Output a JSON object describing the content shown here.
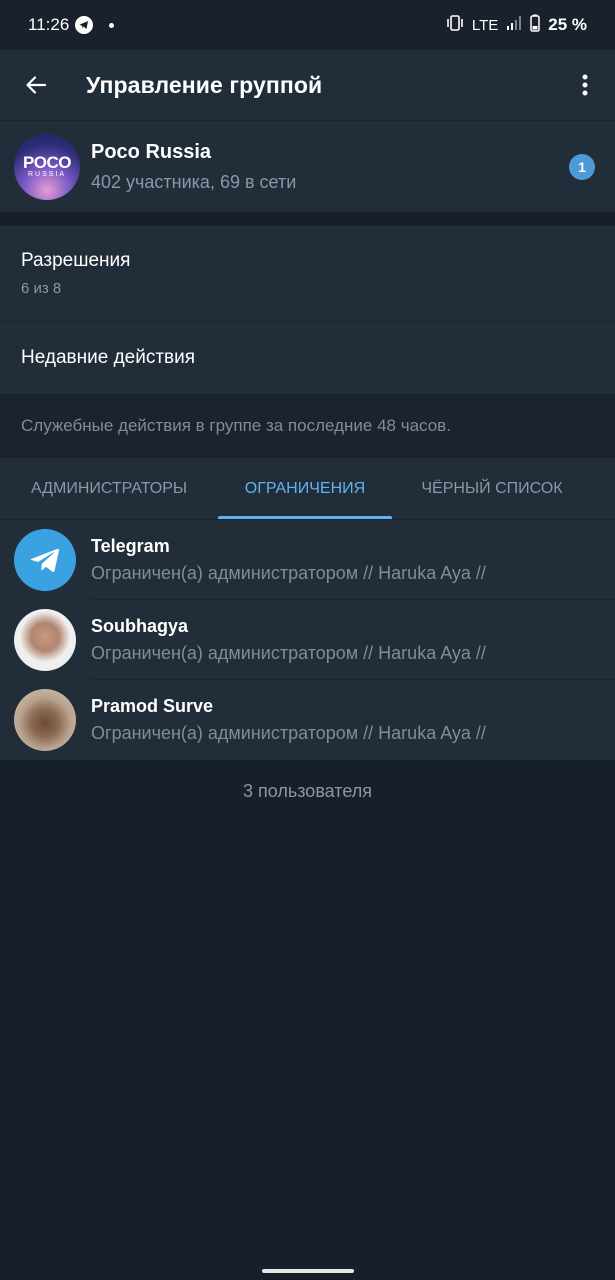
{
  "status_bar": {
    "time": "11:26",
    "network": "LTE",
    "battery": "25 %"
  },
  "app_bar": {
    "title": "Управление группой"
  },
  "group": {
    "name": "Poco Russia",
    "subtitle": "402 участника, 69 в сети",
    "avatar_text": "POCO",
    "avatar_subtext": "RUSSIA",
    "badge": "1"
  },
  "permissions": {
    "label": "Разрешения",
    "value": "6 из 8"
  },
  "recent_actions": {
    "label": "Недавние действия",
    "hint": "Служебные действия в группе за последние 48 часов."
  },
  "tabs": [
    {
      "label": "АДМИНИСТРАТОРЫ",
      "active": false
    },
    {
      "label": "ОГРАНИЧЕНИЯ",
      "active": true
    },
    {
      "label": "ЧЁРНЫЙ СПИСОК",
      "active": false
    }
  ],
  "users": [
    {
      "name": "Telegram",
      "status": "Ограничен(а) администратором // Haruka Aya //"
    },
    {
      "name": "Soubhagya",
      "status": "Ограничен(а) администратором // Haruka Aya //"
    },
    {
      "name": "Pramod Surve",
      "status": "Ограничен(а) администратором // Haruka Aya //"
    }
  ],
  "users_count": "3 пользователя",
  "colors": {
    "background": "#17202a",
    "surface": "#222d3a",
    "accent": "#5fb3f0",
    "badge": "#4e9ad6",
    "secondary_text": "#8a97a5"
  }
}
